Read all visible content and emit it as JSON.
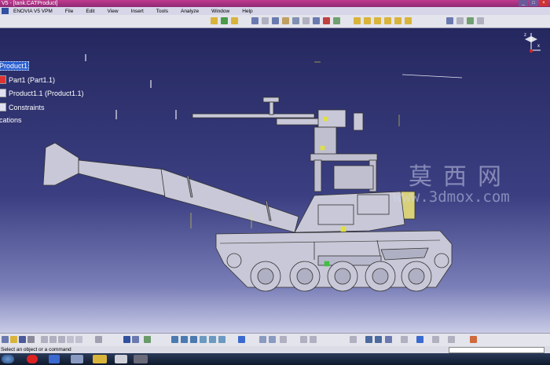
{
  "window": {
    "title": "V5 - [tank.CATProduct]"
  },
  "menu": {
    "items": [
      "ENOVIA V5 VPM",
      "File",
      "Edit",
      "View",
      "Insert",
      "Tools",
      "Analyze",
      "Window",
      "Help"
    ]
  },
  "tree": {
    "root": "Product1",
    "children": [
      "Part1 (Part1.1)",
      "Product1.1 (Product1.1)",
      "Constraints",
      "Applications"
    ]
  },
  "watermark": {
    "text_cn": "莫西网",
    "url": "www.3dmox.com"
  },
  "compass": {
    "axes": {
      "z": "z",
      "x": "x"
    }
  },
  "status": {
    "prompt": "Select an object or a command"
  },
  "colors": {
    "viewport_top": "#25285f",
    "viewport_bottom": "#c9cbe6",
    "selection": "#2a5fd0",
    "titlebar": "#c03a8f"
  },
  "icons": [
    "save-icon",
    "open-icon",
    "new-icon",
    "undo-icon",
    "redo-icon",
    "fly-mode-icon",
    "zoom-in-icon",
    "zoom-out-icon",
    "rotate-icon",
    "pan-icon",
    "normal-view-icon",
    "shading-icon",
    "hide-show-icon",
    "swap-icon"
  ]
}
